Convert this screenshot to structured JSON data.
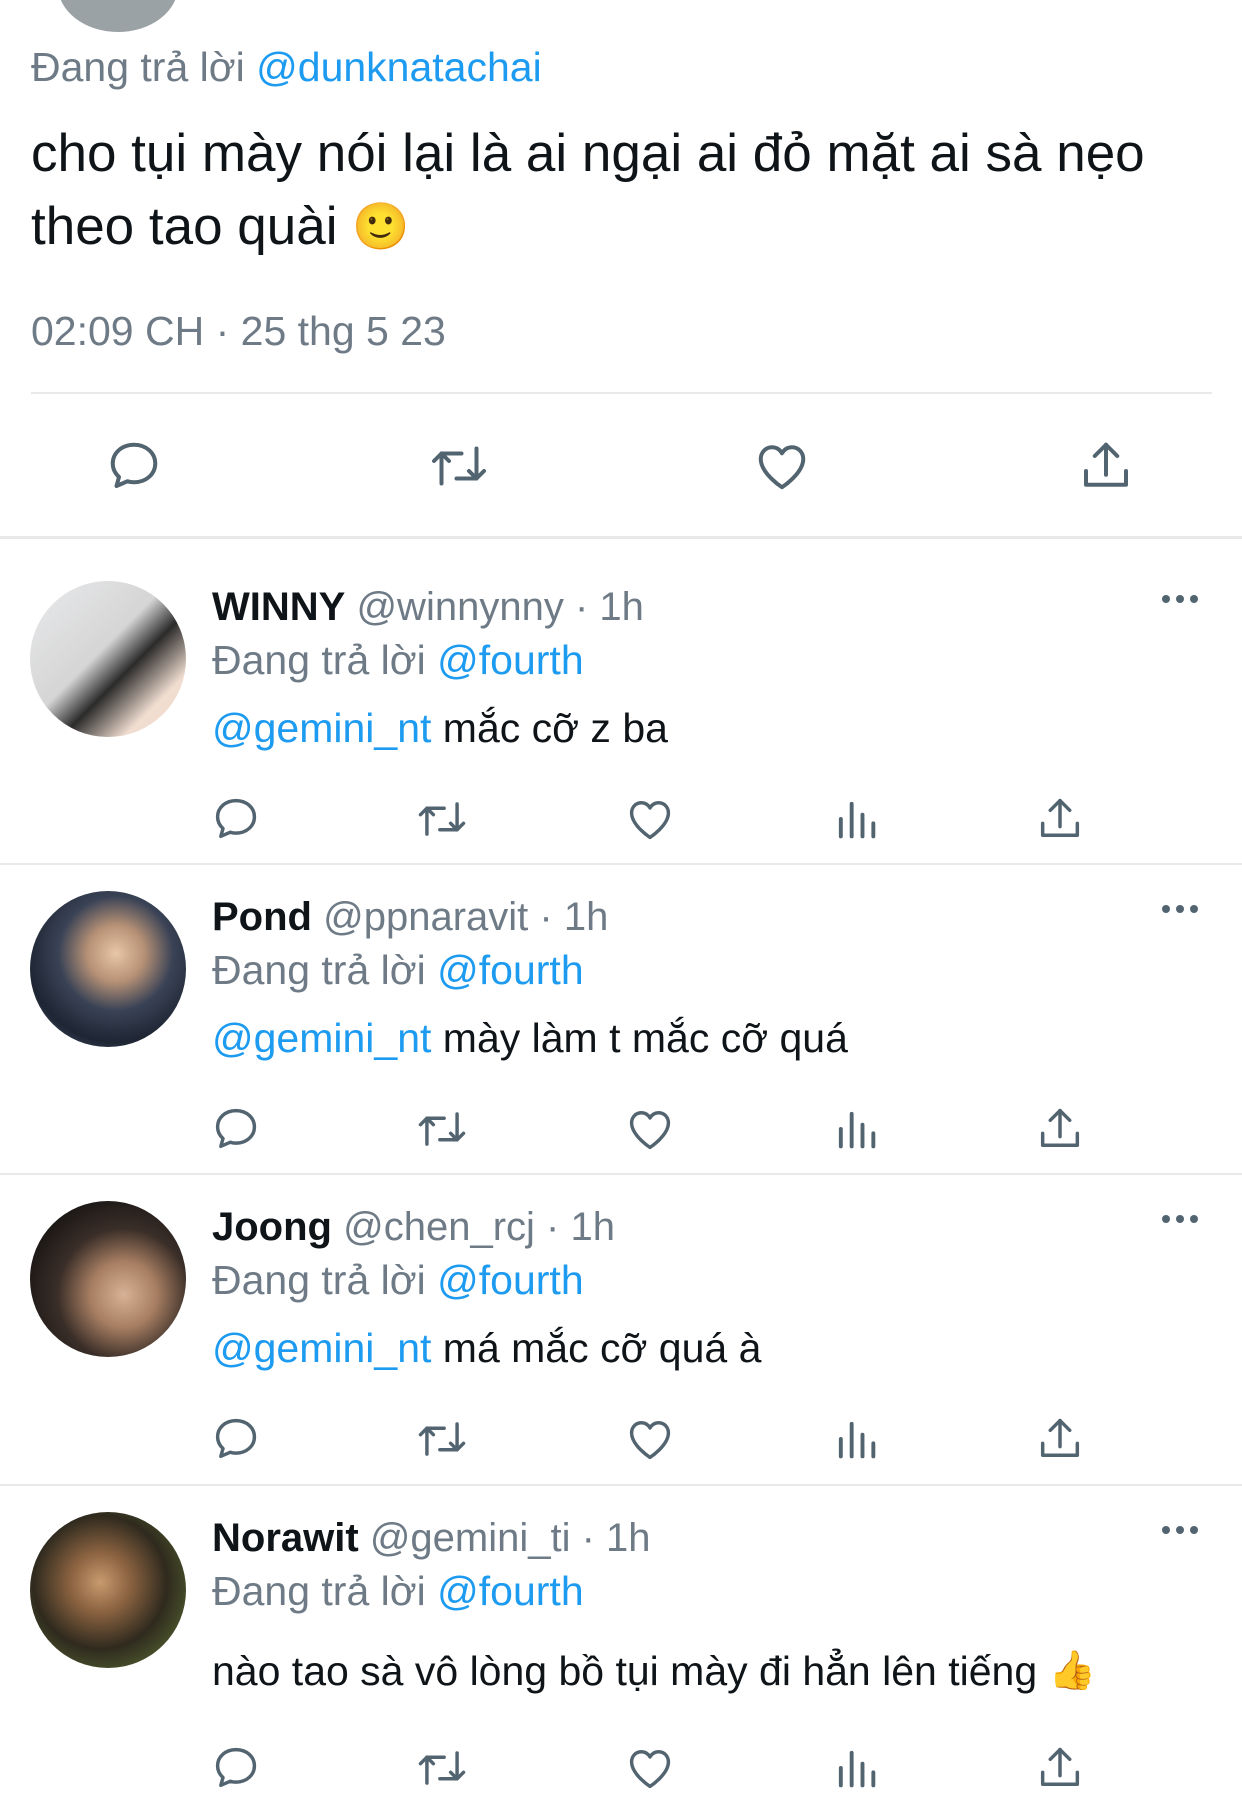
{
  "main_tweet": {
    "replying_prefix": "Đang trả lời",
    "replying_handle": "@dunknatachai",
    "text": "cho tụi mày nói lại là ai ngại ai đỏ mặt ai sà nẹo theo tao quài",
    "emoji": "🙂",
    "timestamp": "02:09 CH · 25 thg 5 23",
    "actions": [
      "reply-icon",
      "retweet-icon",
      "like-icon",
      "share-icon"
    ]
  },
  "replies": [
    {
      "name": "WINNY",
      "handle": "@winnynny",
      "time": "· 1h",
      "replying_prefix": "Đang trả lời",
      "replying_handle": "@fourth",
      "mention": "@gemini_nt",
      "text": " mắc cỡ z ba",
      "emoji": ""
    },
    {
      "name": "Pond",
      "handle": "@ppnaravit",
      "time": "· 1h",
      "replying_prefix": "Đang trả lời",
      "replying_handle": "@fourth",
      "mention": "@gemini_nt",
      "text": " mày làm t mắc cỡ quá",
      "emoji": ""
    },
    {
      "name": "Joong",
      "handle": "@chen_rcj",
      "time": "· 1h",
      "replying_prefix": "Đang trả lời",
      "replying_handle": "@fourth",
      "mention": "@gemini_nt",
      "text": " má mắc cỡ quá à",
      "emoji": ""
    },
    {
      "name": "Norawit",
      "handle": "@gemini_ti",
      "time": "· 1h",
      "replying_prefix": "Đang trả lời",
      "replying_handle": "@fourth",
      "mention": "",
      "text": "nào tao sà vô lòng bồ tụi mày đi hẳn lên tiếng",
      "emoji": "👍"
    }
  ],
  "colors": {
    "link": "#1d9bf0",
    "secondary_text": "#6e7b86",
    "primary_text": "#0f1419",
    "divider": "#e7e9ea"
  }
}
